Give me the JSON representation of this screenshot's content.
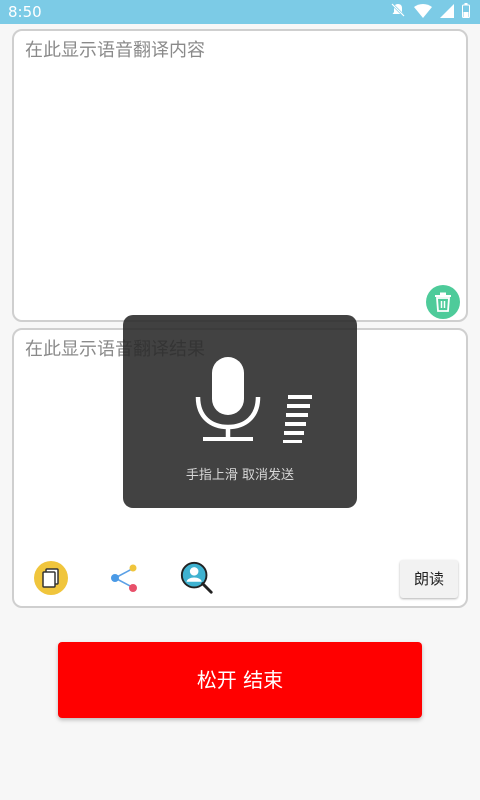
{
  "status_bar": {
    "time": "8:50",
    "icons": [
      "notifications-off-icon",
      "wifi-icon",
      "cell-signal-icon",
      "battery-icon"
    ]
  },
  "source_panel": {
    "placeholder": "在此显示语音翻译内容",
    "delete_icon": "trash-icon"
  },
  "result_panel": {
    "placeholder": "在此显示语音翻译结果",
    "tools": [
      "copy-icon",
      "share-icon",
      "search-icon"
    ],
    "read_button": "朗读"
  },
  "recording_overlay": {
    "icon": "microphone-icon",
    "hint": "手指上滑 取消发送"
  },
  "main_button": {
    "label": "松开 结束"
  },
  "colors": {
    "status_bar": "#7ccbe6",
    "accent_red": "#ff0000",
    "trash_green": "#4ecb9a",
    "copy_yellow": "#f0c53c"
  }
}
